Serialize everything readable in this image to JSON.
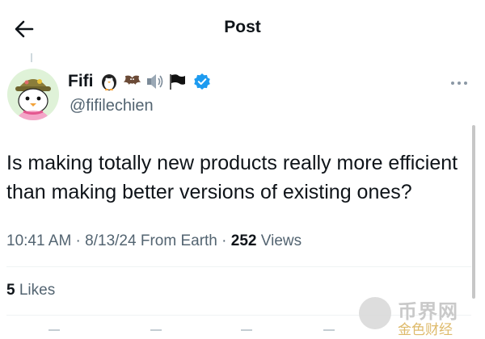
{
  "header": {
    "title": "Post",
    "back_icon": "arrow-left-icon"
  },
  "author": {
    "display_name": "Fifi",
    "handle": "@fifilechien",
    "emoji_icons": [
      "penguin-emoji-icon",
      "bat-emoji-icon",
      "speaker-emoji-icon",
      "black-flag-emoji-icon"
    ],
    "verified_icon": "verified-badge-icon",
    "avatar_icon": "penguin-avatar"
  },
  "post": {
    "text": "Is making totally new products really more efficient than making better versions of existing ones?",
    "time": "10:41 AM",
    "date": "8/13/24",
    "source": "From Earth",
    "views_count": "252",
    "views_label": "Views",
    "sep1": " · ",
    "sep2": " · "
  },
  "engagement": {
    "likes_count": "5",
    "likes_label": "Likes"
  },
  "watermark": {
    "line1": "币界网",
    "line2": "金色财经"
  },
  "colors": {
    "accent": "#1d9bf0",
    "text": "#0f1419",
    "muted": "#536471",
    "divider": "#eff3f4"
  }
}
